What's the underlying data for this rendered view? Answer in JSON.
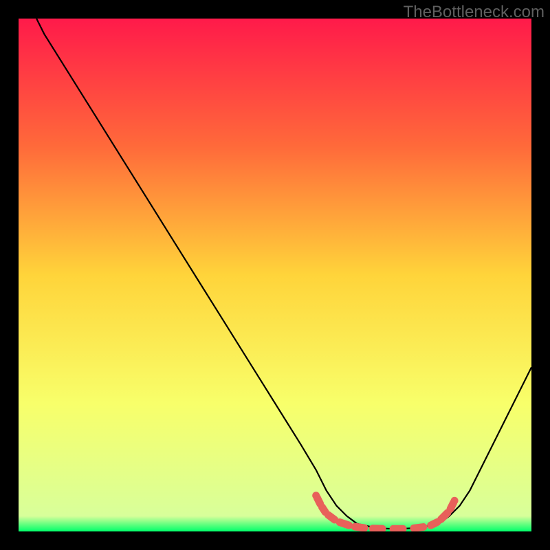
{
  "watermark": "TheBottleneck.com",
  "chart_data": {
    "type": "line",
    "title": "",
    "xlabel": "",
    "ylabel": "",
    "xlim": [
      0,
      100
    ],
    "ylim": [
      0,
      100
    ],
    "gradient_stops": [
      {
        "offset": 0,
        "color": "#ff1a4a"
      },
      {
        "offset": 25,
        "color": "#ff6a3a"
      },
      {
        "offset": 50,
        "color": "#ffd43a"
      },
      {
        "offset": 75,
        "color": "#f8ff6a"
      },
      {
        "offset": 97,
        "color": "#d8ff9a"
      },
      {
        "offset": 100,
        "color": "#00ff6a"
      }
    ],
    "series": [
      {
        "name": "curve",
        "color": "#000000",
        "points": [
          {
            "x": 3.5,
            "y": 100
          },
          {
            "x": 5,
            "y": 97
          },
          {
            "x": 10,
            "y": 89
          },
          {
            "x": 15,
            "y": 81
          },
          {
            "x": 20,
            "y": 73
          },
          {
            "x": 25,
            "y": 65
          },
          {
            "x": 30,
            "y": 57
          },
          {
            "x": 35,
            "y": 49
          },
          {
            "x": 40,
            "y": 41
          },
          {
            "x": 45,
            "y": 33
          },
          {
            "x": 50,
            "y": 25
          },
          {
            "x": 55,
            "y": 17
          },
          {
            "x": 58,
            "y": 12
          },
          {
            "x": 60,
            "y": 8
          },
          {
            "x": 62,
            "y": 5
          },
          {
            "x": 64,
            "y": 3
          },
          {
            "x": 66,
            "y": 1.5
          },
          {
            "x": 70,
            "y": 0.6
          },
          {
            "x": 74,
            "y": 0.5
          },
          {
            "x": 78,
            "y": 0.7
          },
          {
            "x": 82,
            "y": 1.5
          },
          {
            "x": 84,
            "y": 3
          },
          {
            "x": 86,
            "y": 5
          },
          {
            "x": 88,
            "y": 8
          },
          {
            "x": 90,
            "y": 12
          },
          {
            "x": 95,
            "y": 22
          },
          {
            "x": 100,
            "y": 32
          }
        ]
      },
      {
        "name": "bottom-markers",
        "color": "#e8605a",
        "style": "dashed-thick",
        "points": [
          {
            "x": 58,
            "y": 7
          },
          {
            "x": 59,
            "y": 5
          },
          {
            "x": 60,
            "y": 3.5
          },
          {
            "x": 62,
            "y": 2
          },
          {
            "x": 65,
            "y": 1
          },
          {
            "x": 68,
            "y": 0.6
          },
          {
            "x": 72,
            "y": 0.5
          },
          {
            "x": 76,
            "y": 0.5
          },
          {
            "x": 80,
            "y": 1
          },
          {
            "x": 82,
            "y": 2
          },
          {
            "x": 84,
            "y": 4
          },
          {
            "x": 85,
            "y": 6
          }
        ]
      }
    ]
  }
}
